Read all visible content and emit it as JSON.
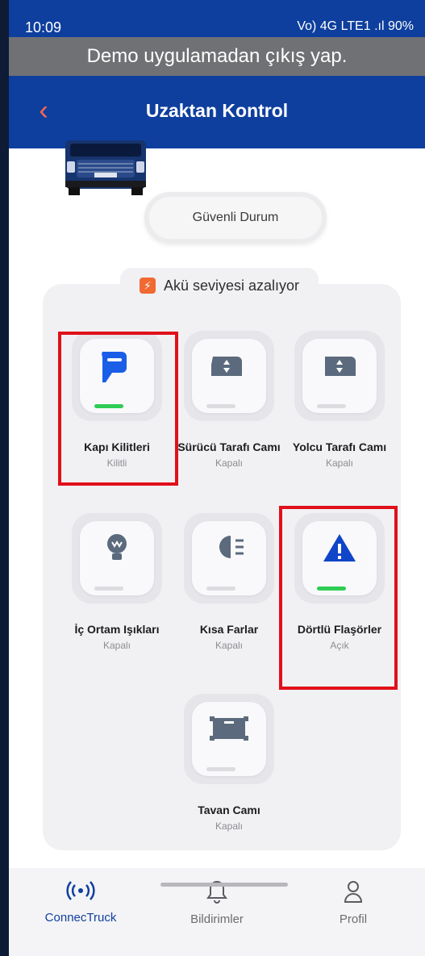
{
  "status_bar": {
    "time": "10:09",
    "indicators": "Vo) 4G LTE1 .ıl",
    "battery": "90%"
  },
  "demo_banner": "Demo uygulamadan çıkış yap.",
  "header": {
    "title": "Uzaktan Kontrol",
    "back_icon": "chevron-left-icon"
  },
  "safe_mode": "Güvenli Durum",
  "battery_warning": {
    "text": "Akü seviyesi azalıyor",
    "icon": "battery-alert-icon"
  },
  "controls": [
    {
      "label": "Kapı Kilitleri",
      "state": "Kilitli",
      "icon": "door-lock-icon",
      "active": true
    },
    {
      "label": "Sürücü Tarafı Camı",
      "state": "Kapalı",
      "icon": "driver-window-icon",
      "active": false
    },
    {
      "label": "Yolcu Tarafı Camı",
      "state": "Kapalı",
      "icon": "passenger-window-icon",
      "active": false
    },
    {
      "label": "İç Ortam Işıkları",
      "state": "Kapalı",
      "icon": "interior-light-icon",
      "active": false
    },
    {
      "label": "Kısa Farlar",
      "state": "Kapalı",
      "icon": "low-beam-icon",
      "active": false
    },
    {
      "label": "Dörtlü Flaşörler",
      "state": "Açık",
      "icon": "hazard-warning-icon",
      "active": true
    },
    {
      "label": "Tavan Camı",
      "state": "Kapalı",
      "icon": "sunroof-icon",
      "active": false
    }
  ],
  "nav": [
    {
      "label": "ConnecTruck",
      "icon": "signal-icon",
      "active": true
    },
    {
      "label": "Bildirimler",
      "icon": "bell-icon",
      "active": false
    },
    {
      "label": "Profil",
      "icon": "user-icon",
      "active": false
    }
  ],
  "colors": {
    "brand_blue": "#0e3f9e",
    "back_orange": "#ff6a4c",
    "active_green": "#2ecc55",
    "highlight_red": "#e0101a"
  }
}
